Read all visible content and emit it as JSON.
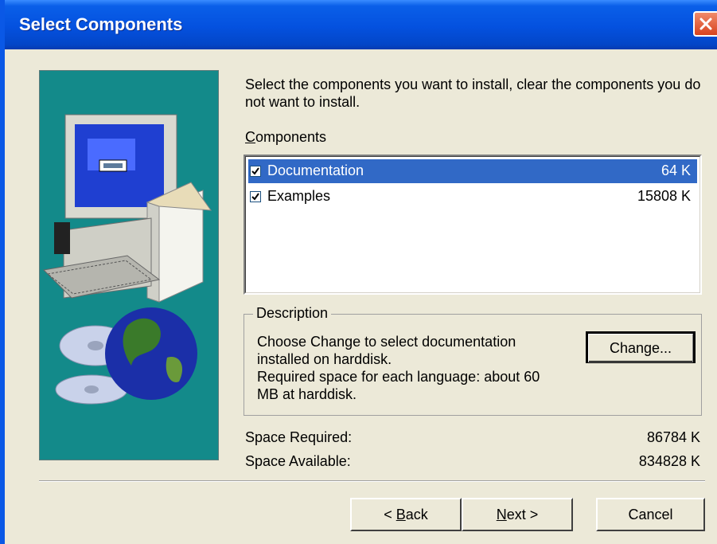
{
  "window": {
    "title": "Select Components",
    "close_icon": "close-icon"
  },
  "main": {
    "intro": "Select the components you want to install, clear the components you do not want to install.",
    "components_label_first": "C",
    "components_label_rest": "omponents",
    "components": [
      {
        "name": "Documentation",
        "size": "64 K",
        "checked": true,
        "selected": true
      },
      {
        "name": "Examples",
        "size": "15808 K",
        "checked": true,
        "selected": false
      }
    ],
    "description": {
      "legend": "Description",
      "text_line1": "Choose Change to select documentation",
      "text_line2": "installed on harddisk.",
      "text_line3": "Required space for each language: about 60",
      "text_line4": "MB at harddisk.",
      "change_label": "Change..."
    },
    "space_required_label": "Space Required:",
    "space_required_value": "86784 K",
    "space_available_label": "Space Available:",
    "space_available_value": "834828 K"
  },
  "buttons": {
    "back_prefix": "< ",
    "back_accel": "B",
    "back_rest": "ack",
    "next_accel": "N",
    "next_rest": "ext >",
    "cancel": "Cancel"
  },
  "colors": {
    "titlebar": "#0451df",
    "selection": "#3169c6",
    "panel_bg": "#138a8a"
  }
}
